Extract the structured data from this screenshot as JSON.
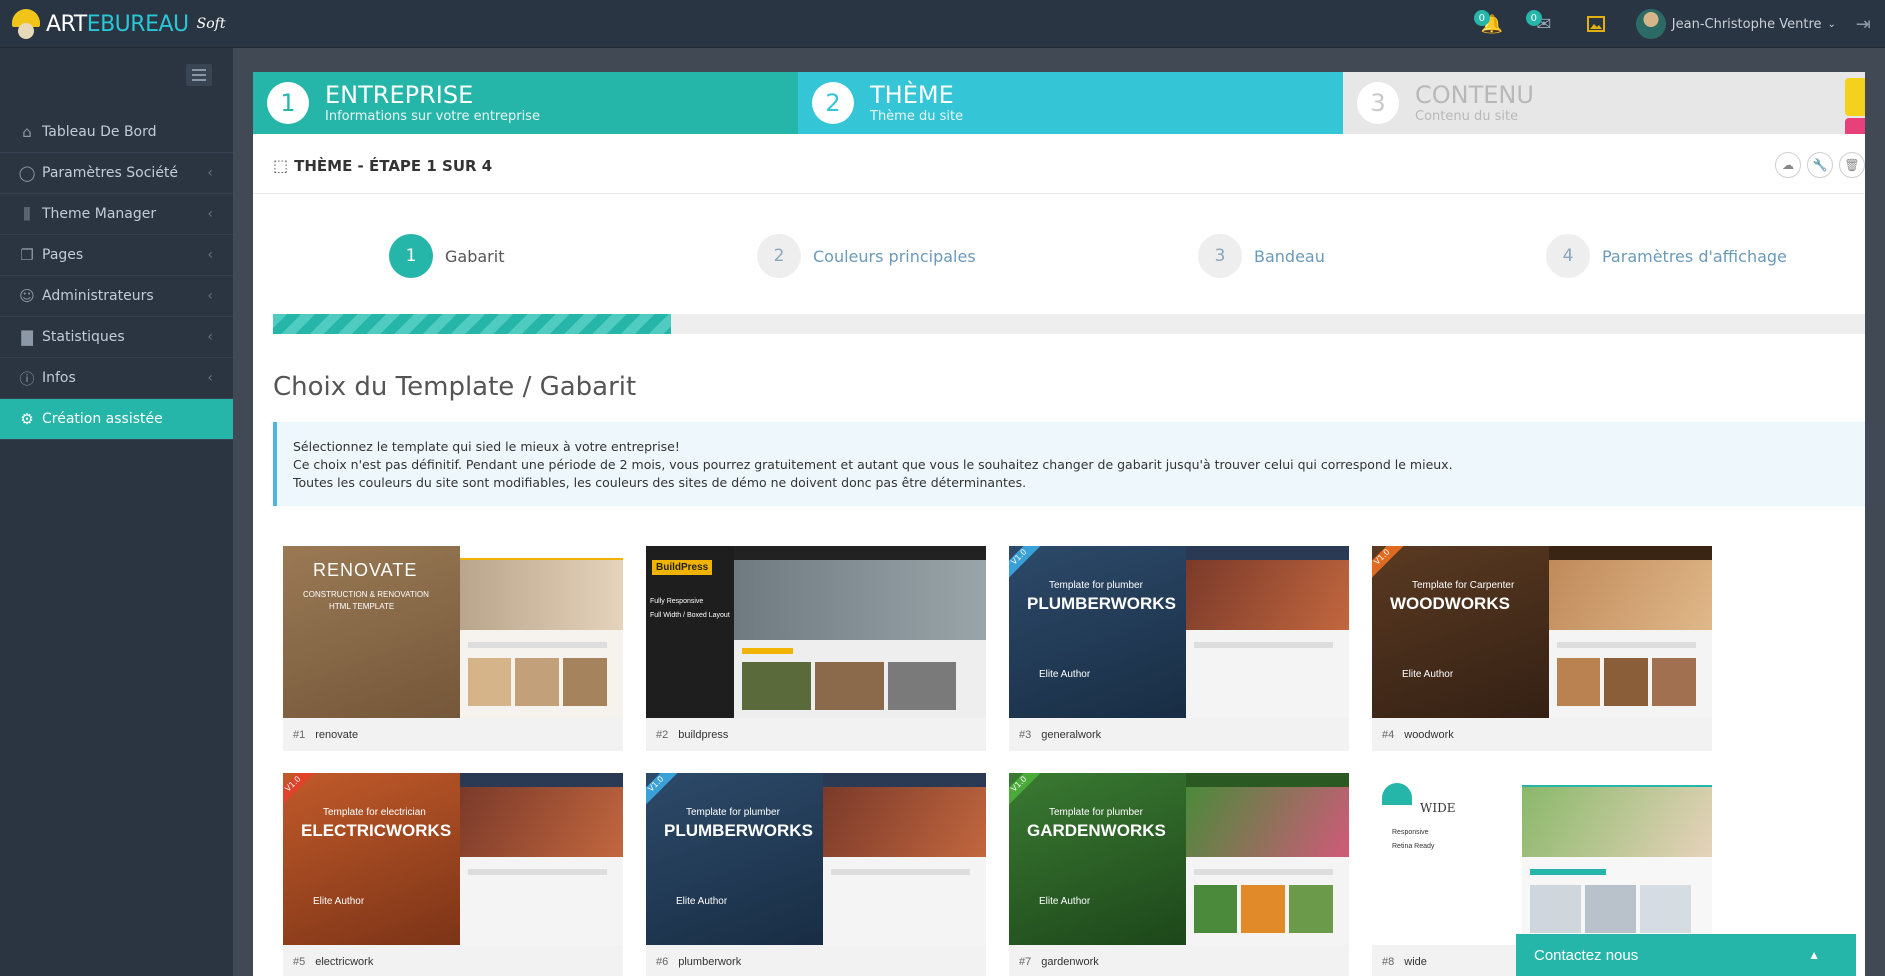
{
  "brand": {
    "name_pre": "ART",
    "name_e": "E",
    "name_post": "BUREAU",
    "soft": "Soft"
  },
  "topbar": {
    "notifications_count": "0",
    "messages_count": "0",
    "user_name": "Jean-Christophe Ventre"
  },
  "sidebar": {
    "items": [
      {
        "label": "Tableau De Bord",
        "icon": "home-icon"
      },
      {
        "label": "Paramètres Société",
        "icon": "bulb-icon"
      },
      {
        "label": "Theme Manager",
        "icon": "sliders-icon"
      },
      {
        "label": "Pages",
        "icon": "pages-icon"
      },
      {
        "label": "Administrateurs",
        "icon": "user-icon"
      },
      {
        "label": "Statistiques",
        "icon": "chart-icon"
      },
      {
        "label": "Infos",
        "icon": "info-icon"
      },
      {
        "label": "Création assistée",
        "icon": "gear-icon"
      }
    ]
  },
  "wizard": {
    "steps": [
      {
        "num": "1",
        "title": "ENTREPRISE",
        "subtitle": "Informations sur votre entreprise"
      },
      {
        "num": "2",
        "title": "THÈME",
        "subtitle": "Thème du site"
      },
      {
        "num": "3",
        "title": "CONTENU",
        "subtitle": "Contenu du site"
      }
    ]
  },
  "panel": {
    "title": "THÈME - ÉTAPE 1 SUR 4",
    "substeps": [
      {
        "num": "1",
        "label": "Gabarit"
      },
      {
        "num": "2",
        "label": "Couleurs principales"
      },
      {
        "num": "3",
        "label": "Bandeau"
      },
      {
        "num": "4",
        "label": "Paramètres d'affichage"
      }
    ],
    "progress": 0.25,
    "section_title": "Choix du Template / Gabarit",
    "info_lines": [
      "Sélectionnez le template qui sied le mieux à votre entreprise!",
      "Ce choix n'est pas définitif. Pendant une période de 2 mois, vous pourrez gratuitement et autant que vous le souhaitez changer de gabarit jusqu'à trouver celui qui correspond le mieux.",
      "Toutes les couleurs du site sont modifiables, les couleurs des sites de démo ne doivent donc pas être déterminantes."
    ]
  },
  "templates": [
    {
      "id": "#1",
      "name": "renovate",
      "thumb_big": "RENOVATE",
      "thumb_small": "CONSTRUCTION & RENOVATION",
      "thumb_small2": "HTML TEMPLATE",
      "author": ""
    },
    {
      "id": "#2",
      "name": "buildpress",
      "thumb_big": "BuildPress",
      "thumb_small": "Fully Responsive",
      "thumb_small2": "Full Width / Boxed Layout",
      "author": ""
    },
    {
      "id": "#3",
      "name": "generalwork",
      "thumb_big": "PLUMBERWORKS",
      "thumb_small": "Template for plumber",
      "thumb_small2": "",
      "author": "Elite Author"
    },
    {
      "id": "#4",
      "name": "woodwork",
      "thumb_big": "WOODWORKS",
      "thumb_small": "Template for Carpenter",
      "thumb_small2": "",
      "author": "Elite Author"
    },
    {
      "id": "#5",
      "name": "electricwork",
      "thumb_big": "ELECTRICWORKS",
      "thumb_small": "Template for electrician",
      "thumb_small2": "",
      "author": "Elite Author"
    },
    {
      "id": "#6",
      "name": "plumberwork",
      "thumb_big": "PLUMBERWORKS",
      "thumb_small": "Template for plumber",
      "thumb_small2": "",
      "author": "Elite Author"
    },
    {
      "id": "#7",
      "name": "gardenwork",
      "thumb_big": "GARDENWORKS",
      "thumb_small": "Template for plumber",
      "thumb_small2": "",
      "author": "Elite Author"
    },
    {
      "id": "#8",
      "name": "wide",
      "thumb_big": "WIDE",
      "thumb_small": "Responsive",
      "thumb_small2": "Retina Ready",
      "author": ""
    }
  ],
  "contact": {
    "label": "Contactez nous"
  },
  "colors": {
    "accent": "#26b6a9",
    "accent2": "#34c6d6",
    "sidebar": "#2b3542",
    "topbar": "#2a3543",
    "info_border": "#4db7dd"
  }
}
